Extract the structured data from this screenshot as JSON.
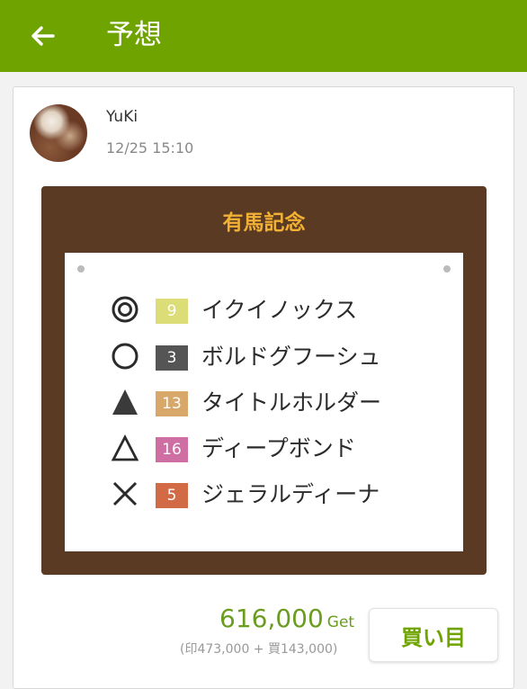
{
  "header": {
    "title": "予想"
  },
  "post": {
    "user": "YuKi",
    "timestamp": "12/25 15:10"
  },
  "race": {
    "name": "有馬記念"
  },
  "picks": [
    {
      "mark": "double-circle",
      "number": "9",
      "color": "#dddd77",
      "horse": "イクイノックス"
    },
    {
      "mark": "circle",
      "number": "3",
      "color": "#555555",
      "horse": "ボルドグフーシュ"
    },
    {
      "mark": "filled-triangle",
      "number": "13",
      "color": "#d7a86a",
      "horse": "タイトルホルダー"
    },
    {
      "mark": "triangle",
      "number": "16",
      "color": "#cf6ea3",
      "horse": "ディープボンド"
    },
    {
      "mark": "cross",
      "number": "5",
      "color": "#d26a45",
      "horse": "ジェラルディーナ"
    }
  ],
  "result": {
    "amount": "616,000",
    "unit": "Get",
    "breakdown": "(印473,000 + 買143,000)"
  },
  "actions": {
    "buy_label": "買い目"
  },
  "colors": {
    "accent": "#6fa300",
    "board": "#5a3a22",
    "race_title": "#f2b134"
  }
}
